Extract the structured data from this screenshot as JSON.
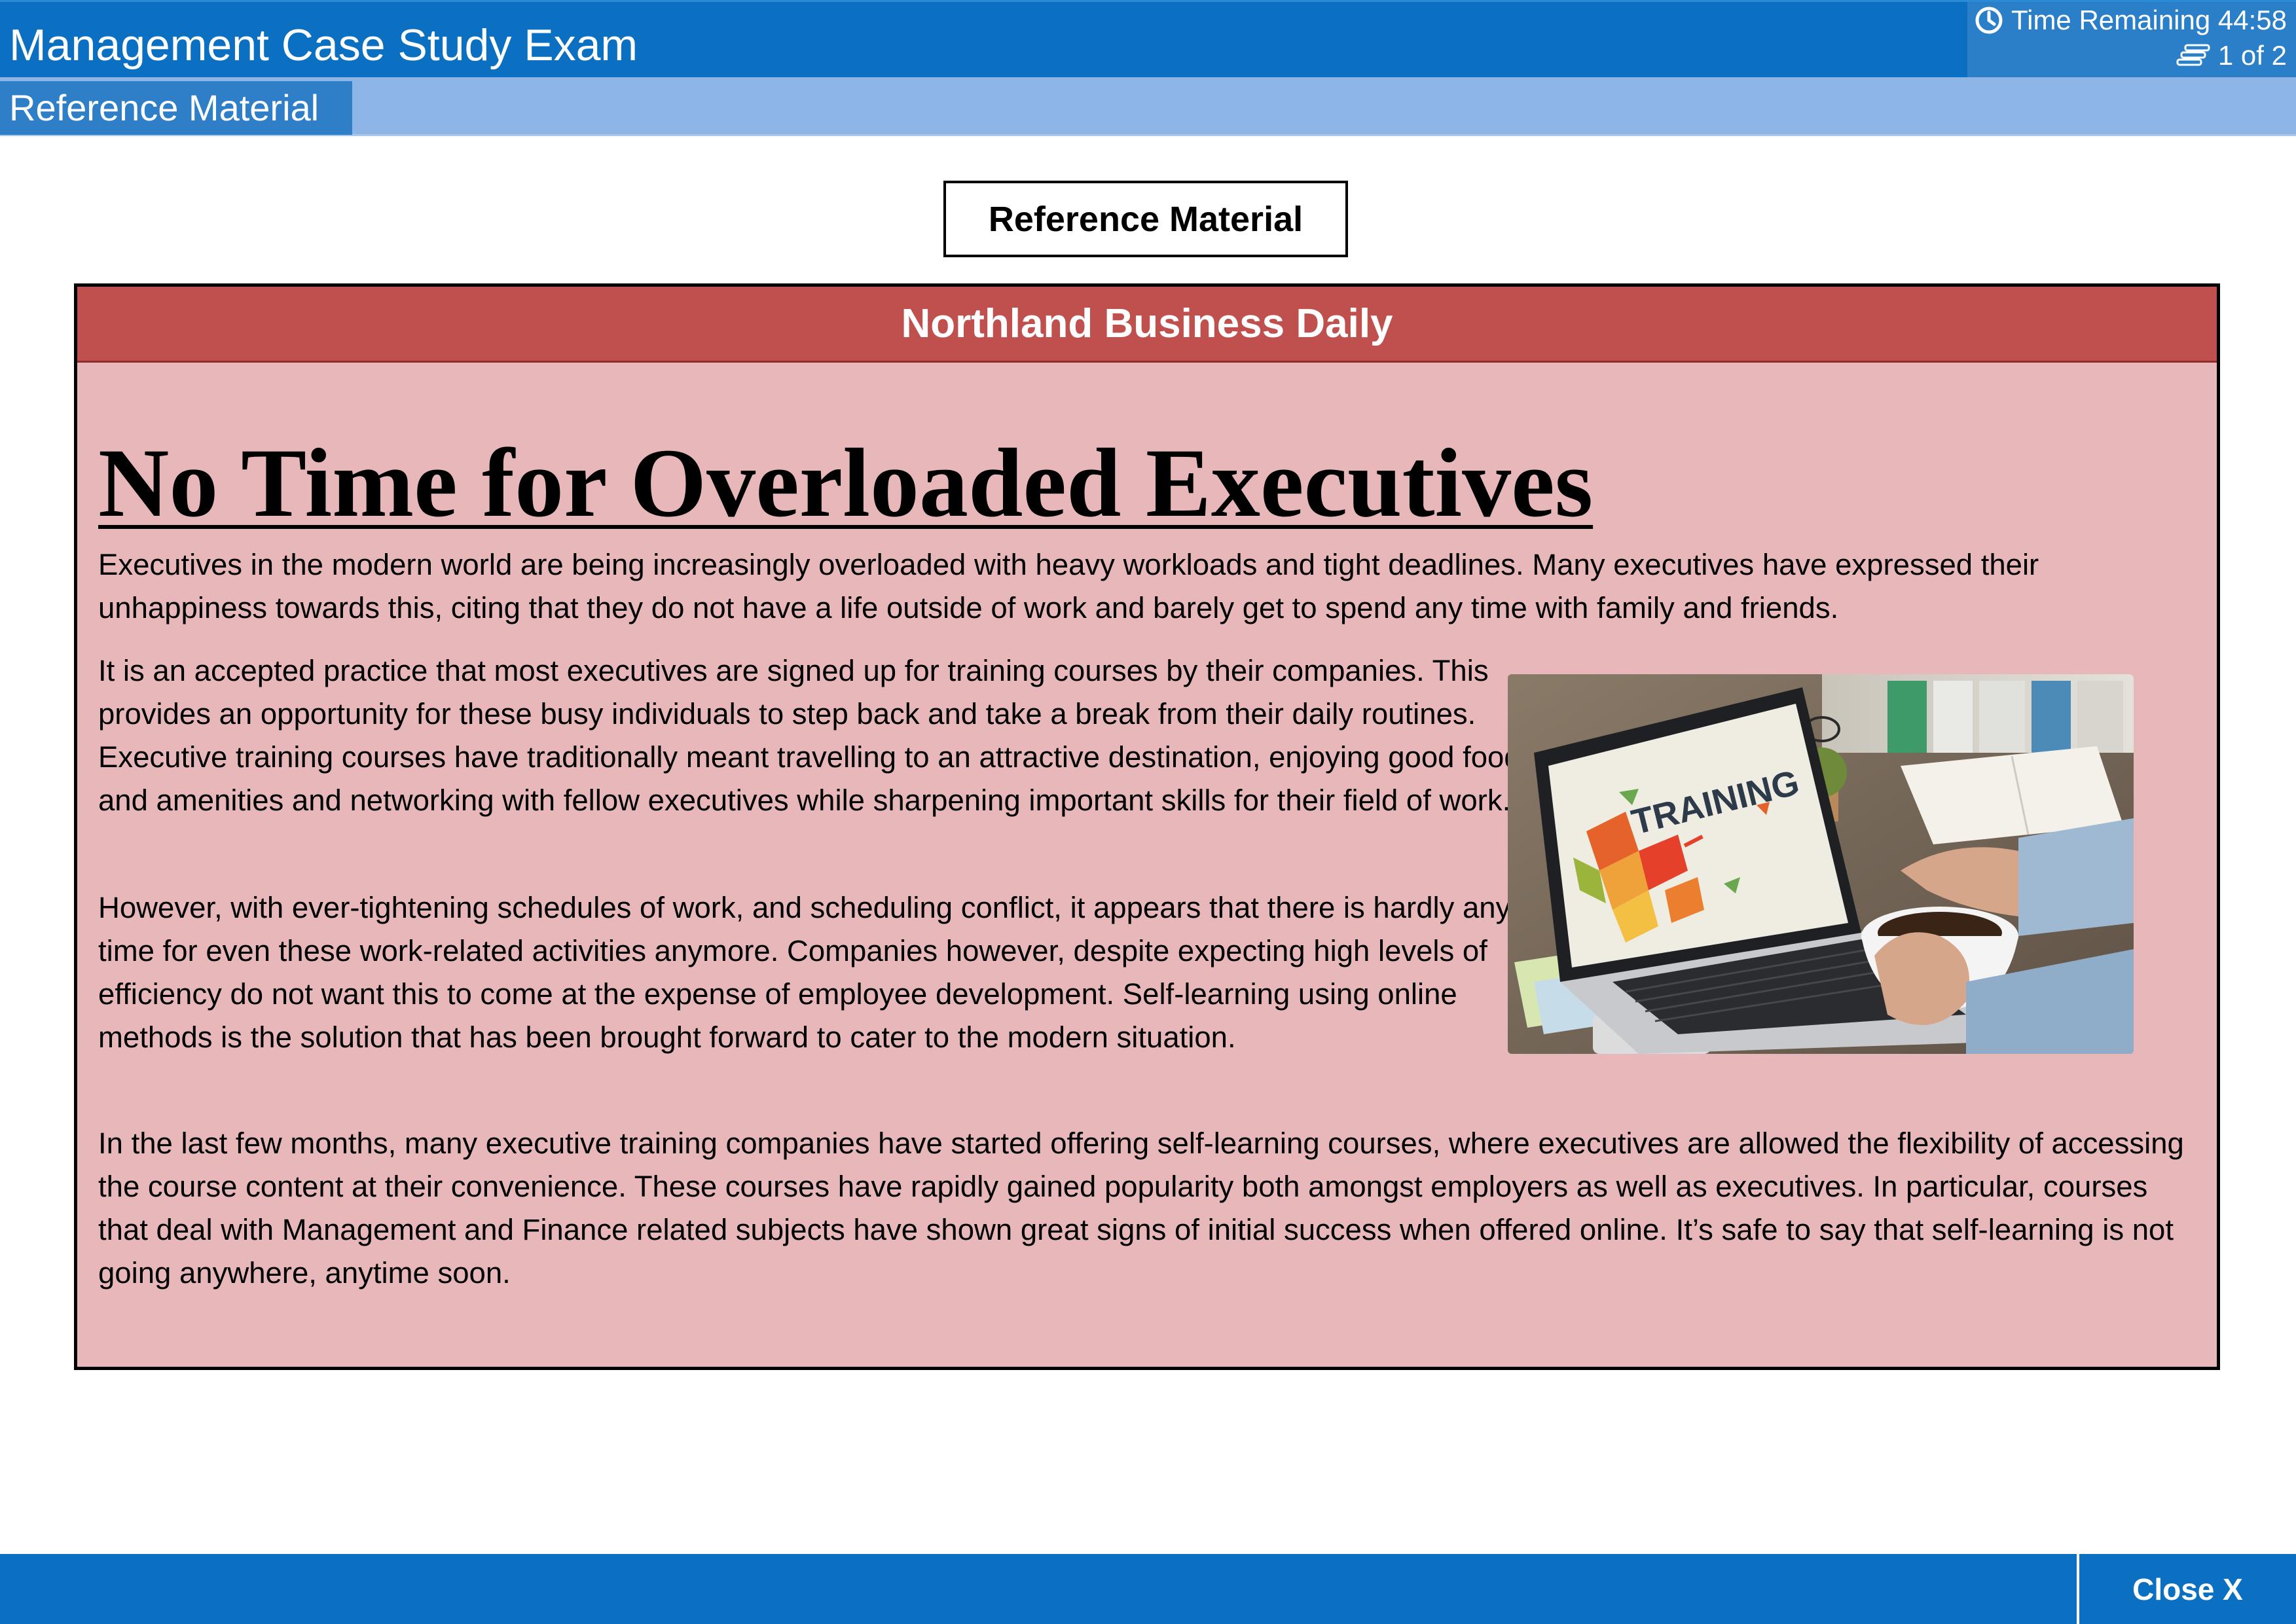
{
  "app": {
    "title": "Management Case Study Exam"
  },
  "status": {
    "time_remaining": "Time Remaining 44:58",
    "page_indicator": "1 of 2"
  },
  "toolbar": {
    "tab_label": "Reference Material"
  },
  "reference_label": "Reference Material",
  "article": {
    "publication": "Northland Business Daily",
    "headline": "No Time for Overloaded Executives",
    "paragraphs": [
      "Executives in the modern world are being increasingly overloaded with heavy workloads and tight deadlines. Many executives have expressed their unhappiness towards this, citing that they do not have a life outside of work and barely get to spend any time with family and friends.",
      "It is an accepted practice that most executives are signed up for training courses by their companies. This provides an opportunity for these busy individuals to step back and take a break from their daily routines. Executive training courses have traditionally meant travelling to an attractive destination, enjoying good food and amenities and networking with fellow executives while sharpening important skills for their field of work.",
      "However, with ever-tightening schedules of work, and scheduling conflict, it appears that there is hardly any time for even these work-related activities anymore. Companies however, despite expecting high levels of efficiency do not want this to come at the expense of employee development. Self-learning using online methods is the solution that has been brought forward to cater to the modern situation.",
      "In the last few months, many executive training companies have started offering self-learning courses, where executives are allowed the flexibility of accessing the course content at their convenience. These courses have rapidly gained popularity both amongst employers as well as executives. In particular, courses that deal with Management and Finance related subjects have shown great signs of initial success when offered online. It’s safe to say that self-learning is not going anywhere, anytime soon."
    ],
    "image_text": "TRAINING"
  },
  "footer": {
    "close_label": "Close X"
  },
  "colors": {
    "header_blue": "#0b70c1",
    "subbar_blue": "#8db6e6",
    "publication_red": "#c0504d",
    "article_pink": "#e8b7b9"
  },
  "icons": {
    "timer": "clock-icon",
    "pager": "pages-icon"
  }
}
